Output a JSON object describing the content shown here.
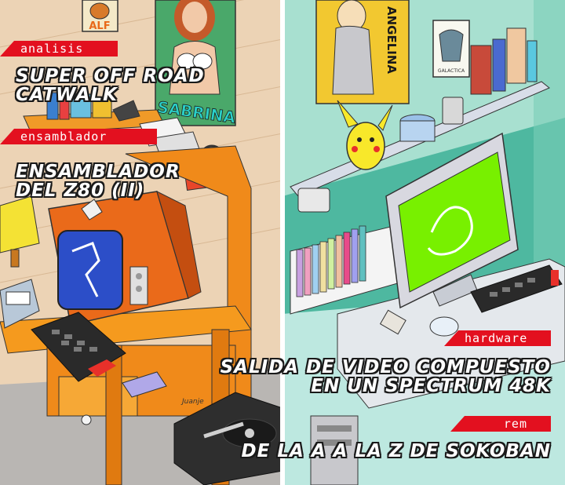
{
  "colors": {
    "tag_background": "#e3101f",
    "headline_text": "#ffffff",
    "headline_outline": "#1a1a1a",
    "divider": "#ffffff"
  },
  "poster_left": {
    "alf": "ALF",
    "sabrina": "SABRINA"
  },
  "poster_right": {
    "angelina": "ANGELINA",
    "galactica": "GALACTICA"
  },
  "artist_signature": "Juanje",
  "articles": [
    {
      "tag": "analisis",
      "title_lines": [
        "SUPER OFF ROAD",
        "CATWALK"
      ]
    },
    {
      "tag": "ensamblador",
      "title_lines": [
        "ENSAMBLADOR",
        "DEL Z80 (II)"
      ]
    },
    {
      "tag": "hardware",
      "title_lines": [
        "SALIDA DE VIDEO COMPUESTO",
        "EN UN SPECTRUM 48K"
      ]
    },
    {
      "tag": "rem",
      "title_lines": [
        "DE LA A A LA Z DE SOKOBAN"
      ]
    }
  ],
  "icons": {
    "left_room": "retro-bedroom-illustration",
    "right_room": "modern-bedroom-illustration"
  }
}
